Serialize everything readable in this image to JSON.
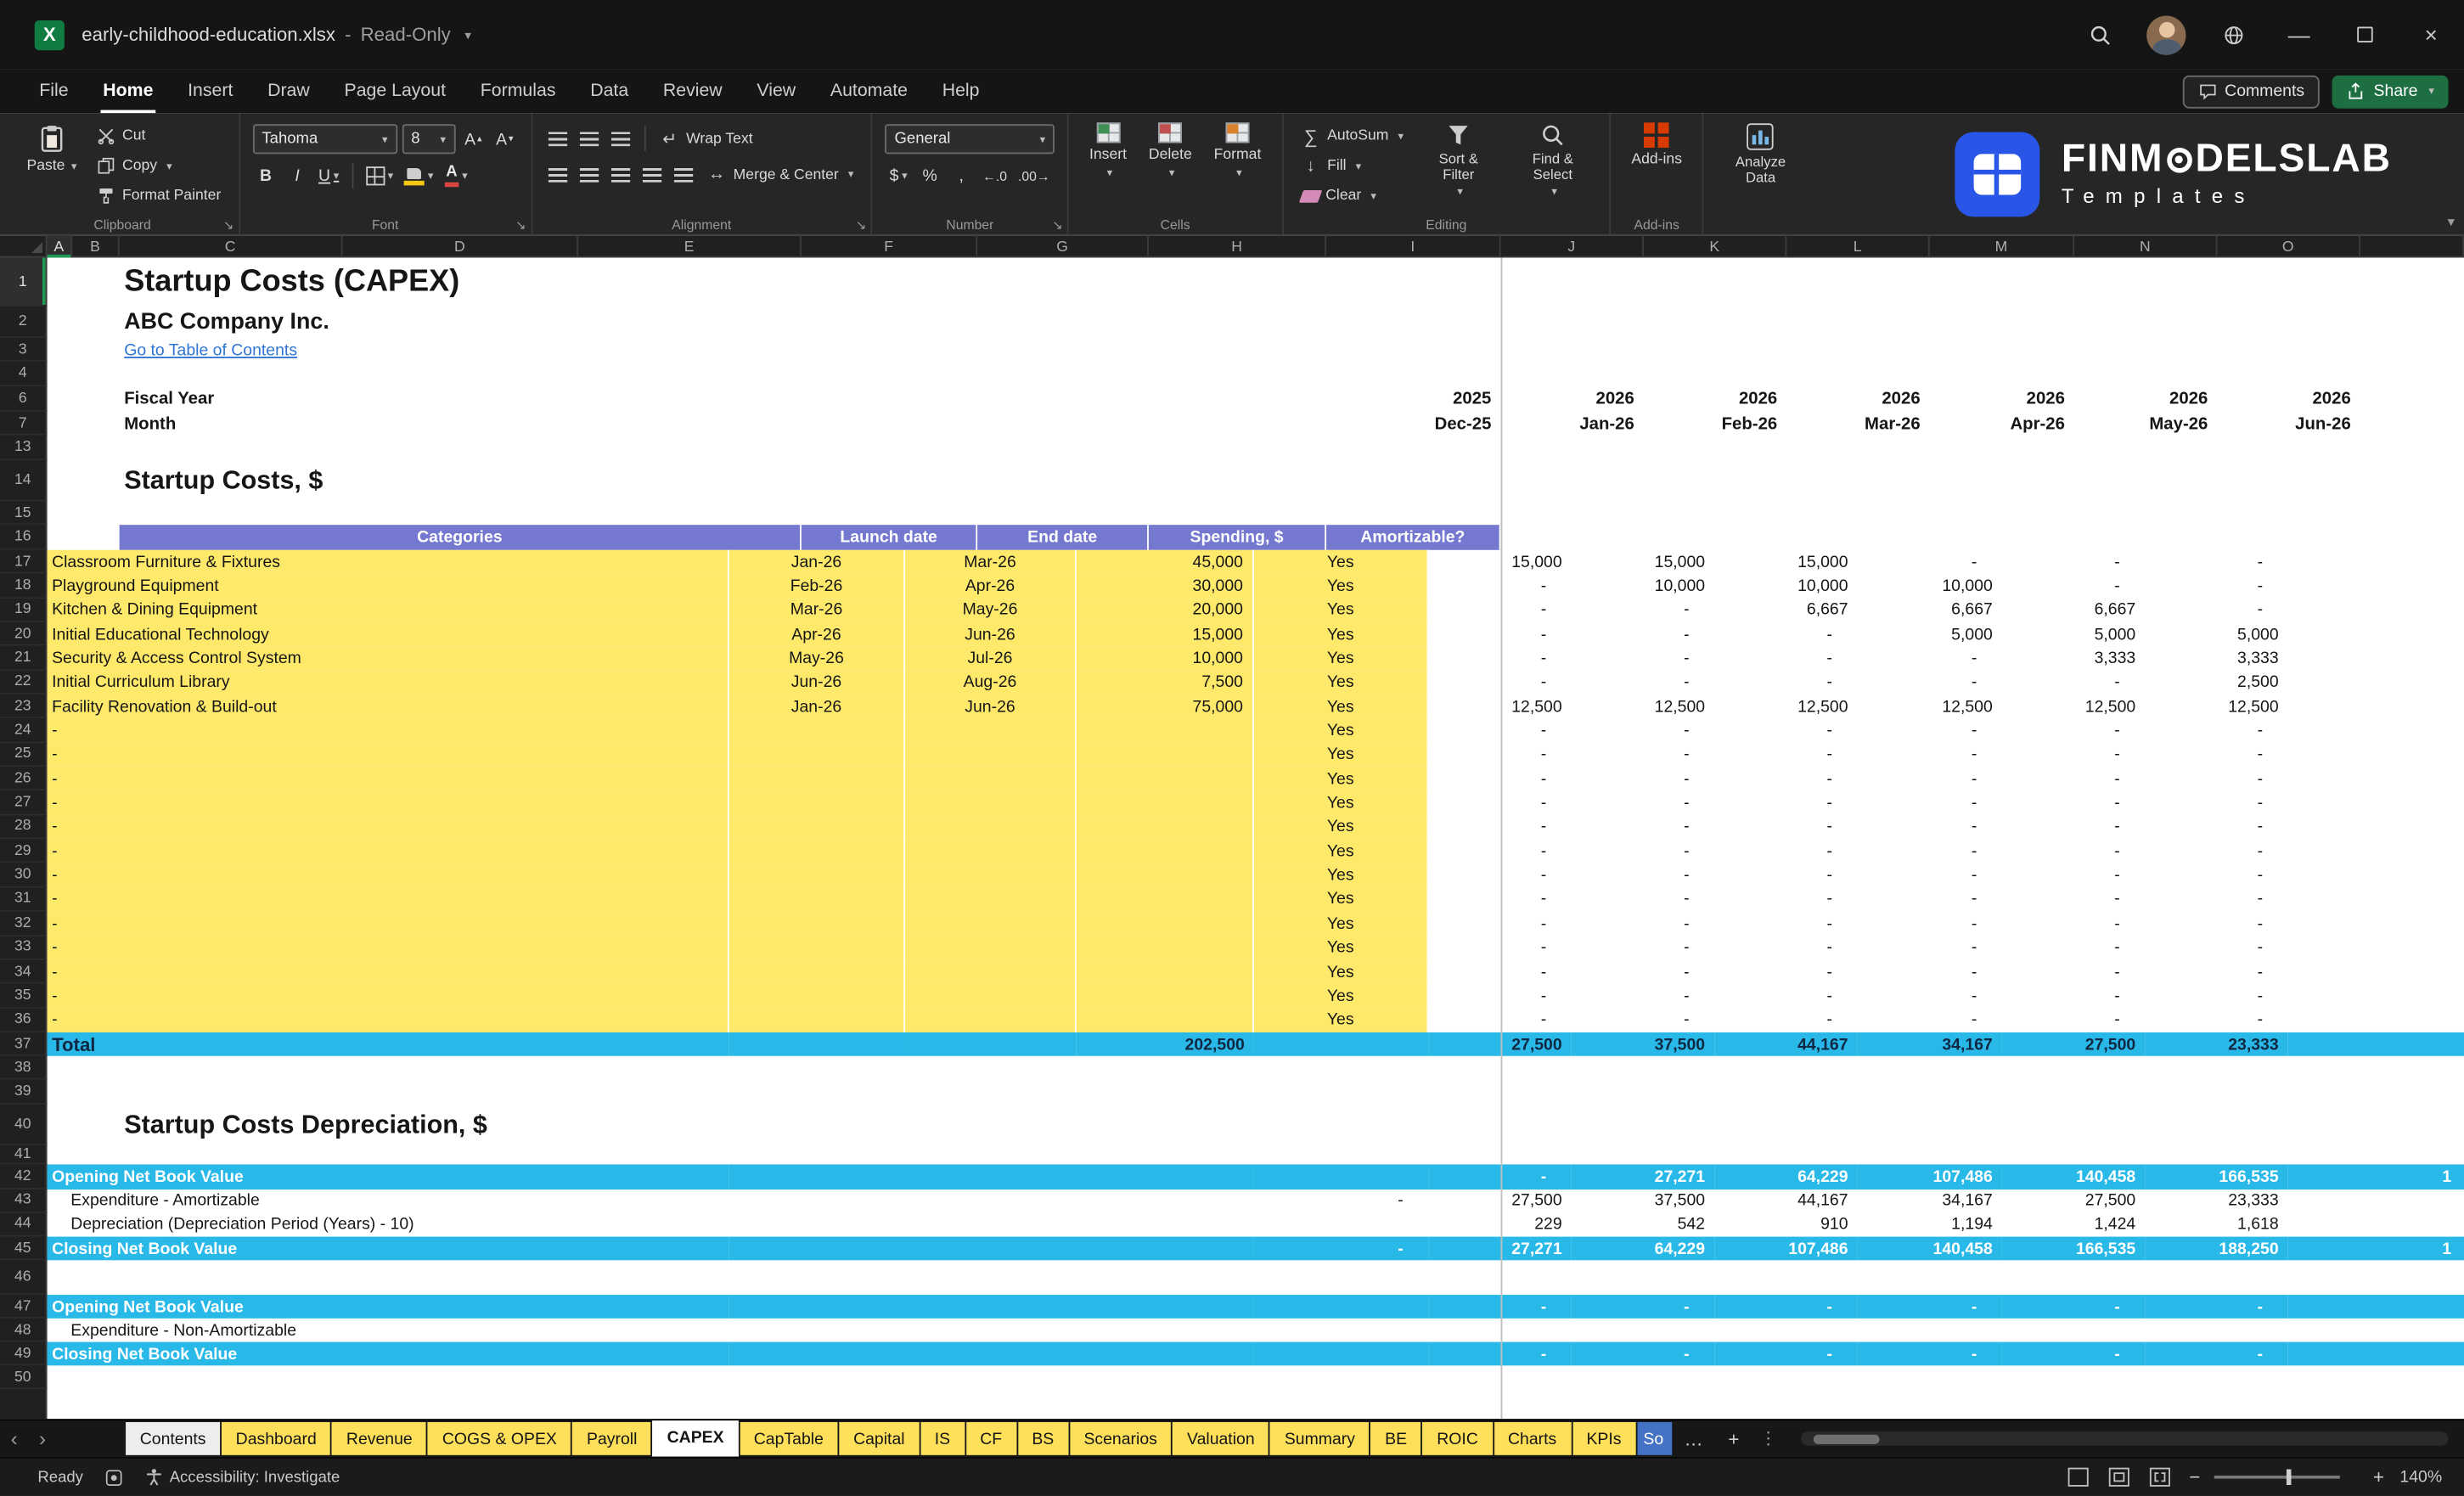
{
  "titlebar": {
    "app_icon_letter": "X",
    "filename": "early-childhood-education.xlsx",
    "separator": "-",
    "mode": "Read-Only"
  },
  "menubar": {
    "items": [
      "File",
      "Home",
      "Insert",
      "Draw",
      "Page Layout",
      "Formulas",
      "Data",
      "Review",
      "View",
      "Automate",
      "Help"
    ],
    "active": "Home",
    "comments_label": "Comments",
    "share_label": "Share"
  },
  "ribbon": {
    "clipboard": {
      "group": "Clipboard",
      "paste": "Paste",
      "cut": "Cut",
      "copy": "Copy",
      "format_painter": "Format Painter"
    },
    "font": {
      "group": "Font",
      "name": "Tahoma",
      "size": "8",
      "bold": "B",
      "italic": "I",
      "underline": "U"
    },
    "alignment": {
      "group": "Alignment",
      "wrap": "Wrap Text",
      "merge": "Merge & Center"
    },
    "number": {
      "group": "Number",
      "format": "General",
      "currency": "$",
      "percent": "%",
      "comma": ","
    },
    "cells": {
      "group": "Cells",
      "insert": "Insert",
      "delete": "Delete",
      "format": "Format"
    },
    "editing": {
      "group": "Editing",
      "autosum": "AutoSum",
      "fill": "Fill",
      "clear": "Clear",
      "sort": "Sort & Filter",
      "find": "Find & Select"
    },
    "addins": {
      "group": "Add-ins",
      "label": "Add-ins",
      "analyze": "Analyze Data"
    },
    "logo": {
      "brand_pre": "FINM",
      "brand_post": "DELSLAB",
      "subtitle": "Templates"
    }
  },
  "grid": {
    "columns": [
      "A",
      "B",
      "C",
      "D",
      "E",
      "F",
      "G",
      "H",
      "I",
      "J",
      "K",
      "L",
      "M",
      "N",
      "O"
    ],
    "rows": [
      "1",
      "2",
      "3",
      "4",
      "6",
      "7",
      "13",
      "14",
      "15",
      "16",
      "17",
      "18",
      "19",
      "20",
      "21",
      "22",
      "23",
      "24",
      "25",
      "26",
      "27",
      "28",
      "29",
      "30",
      "31",
      "32",
      "33",
      "34",
      "35",
      "36",
      "37",
      "38",
      "39",
      "40",
      "41",
      "42",
      "43",
      "44",
      "45",
      "46",
      "47",
      "48",
      "49",
      "50"
    ]
  },
  "sheet": {
    "title": "Startup Costs (CAPEX)",
    "company": "ABC Company Inc.",
    "toc_link": "Go to Table of Contents",
    "fiscal_year_label": "Fiscal Year",
    "month_label": "Month",
    "fy_first": "2025",
    "fy_values": [
      "2026",
      "2026",
      "2026",
      "2026",
      "2026",
      "2026"
    ],
    "month_first": "Dec-25",
    "month_values": [
      "Jan-26",
      "Feb-26",
      "Mar-26",
      "Apr-26",
      "May-26",
      "Jun-26"
    ],
    "section1_title": "Startup Costs, $",
    "header": {
      "categories": "Categories",
      "launch": "Launch date",
      "end": "End date",
      "spending": "Spending, $",
      "amortizable": "Amortizable?"
    },
    "capex_rows": [
      {
        "category": "Classroom Furniture & Fixtures",
        "launch": "Jan-26",
        "end": "Mar-26",
        "spending": "45,000",
        "amortizable": "Yes",
        "months": [
          "15,000",
          "15,000",
          "15,000",
          "-",
          "-",
          "-"
        ]
      },
      {
        "category": "Playground Equipment",
        "launch": "Feb-26",
        "end": "Apr-26",
        "spending": "30,000",
        "amortizable": "Yes",
        "months": [
          "-",
          "10,000",
          "10,000",
          "10,000",
          "-",
          "-"
        ]
      },
      {
        "category": "Kitchen & Dining Equipment",
        "launch": "Mar-26",
        "end": "May-26",
        "spending": "20,000",
        "amortizable": "Yes",
        "months": [
          "-",
          "-",
          "6,667",
          "6,667",
          "6,667",
          "-"
        ]
      },
      {
        "category": "Initial Educational Technology",
        "launch": "Apr-26",
        "end": "Jun-26",
        "spending": "15,000",
        "amortizable": "Yes",
        "months": [
          "-",
          "-",
          "-",
          "5,000",
          "5,000",
          "5,000"
        ]
      },
      {
        "category": "Security & Access Control System",
        "launch": "May-26",
        "end": "Jul-26",
        "spending": "10,000",
        "amortizable": "Yes",
        "months": [
          "-",
          "-",
          "-",
          "-",
          "3,333",
          "3,333"
        ]
      },
      {
        "category": "Initial Curriculum Library",
        "launch": "Jun-26",
        "end": "Aug-26",
        "spending": "7,500",
        "amortizable": "Yes",
        "months": [
          "-",
          "-",
          "-",
          "-",
          "-",
          "2,500"
        ]
      },
      {
        "category": "Facility Renovation & Build-out",
        "launch": "Jan-26",
        "end": "Jun-26",
        "spending": "75,000",
        "amortizable": "Yes",
        "months": [
          "12,500",
          "12,500",
          "12,500",
          "12,500",
          "12,500",
          "12,500"
        ]
      }
    ],
    "placeholder_row": {
      "category": "-",
      "launch": "",
      "end": "",
      "spending": "",
      "amortizable": "Yes",
      "months": [
        "-",
        "-",
        "-",
        "-",
        "-",
        "-"
      ]
    },
    "total_row": {
      "label": "Total",
      "spending": "202,500",
      "months": [
        "27,500",
        "37,500",
        "44,167",
        "34,167",
        "27,500",
        "23,333"
      ]
    },
    "section2_title": "Startup Costs Depreciation, $",
    "dep_rows": [
      {
        "label": "Opening Net Book Value",
        "style": "band",
        "i": "",
        "months": [
          "-",
          "27,271",
          "64,229",
          "107,486",
          "140,458",
          "166,535"
        ],
        "overflow": "1"
      },
      {
        "label": "Expenditure - Amortizable",
        "style": "plain",
        "i": "-",
        "months": [
          "27,500",
          "37,500",
          "44,167",
          "34,167",
          "27,500",
          "23,333"
        ]
      },
      {
        "label": "Depreciation (Depreciation Period (Years) - 10)",
        "style": "plain",
        "i": "",
        "months": [
          "229",
          "542",
          "910",
          "1,194",
          "1,424",
          "1,618"
        ]
      },
      {
        "label": "Closing Net Book Value",
        "style": "band",
        "i": "-",
        "months": [
          "27,271",
          "64,229",
          "107,486",
          "140,458",
          "166,535",
          "188,250"
        ],
        "overflow": "1"
      },
      {
        "label": "Opening Net Book Value",
        "style": "band",
        "i": "",
        "months": [
          "-",
          "-",
          "-",
          "-",
          "-",
          "-"
        ]
      },
      {
        "label": "Expenditure - Non-Amortizable",
        "style": "plain",
        "i": "",
        "months": [
          "",
          "",
          "",
          "",
          "",
          ""
        ]
      },
      {
        "label": "Closing Net Book Value",
        "style": "band",
        "i": "",
        "months": [
          "-",
          "-",
          "-",
          "-",
          "-",
          "-"
        ]
      }
    ]
  },
  "tabs": {
    "items": [
      {
        "label": "Contents",
        "style": "light"
      },
      {
        "label": "Dashboard",
        "style": "yellow"
      },
      {
        "label": "Revenue",
        "style": "yellow"
      },
      {
        "label": "COGS & OPEX",
        "style": "yellow"
      },
      {
        "label": "Payroll",
        "style": "yellow"
      },
      {
        "label": "CAPEX",
        "style": "active"
      },
      {
        "label": "CapTable",
        "style": "yellow"
      },
      {
        "label": "Capital",
        "style": "yellow"
      },
      {
        "label": "IS",
        "style": "yellow"
      },
      {
        "label": "CF",
        "style": "yellow"
      },
      {
        "label": "BS",
        "style": "yellow"
      },
      {
        "label": "Scenarios",
        "style": "yellow"
      },
      {
        "label": "Valuation",
        "style": "yellow"
      },
      {
        "label": "Summary",
        "style": "yellow"
      },
      {
        "label": "BE",
        "style": "yellow"
      },
      {
        "label": "ROIC",
        "style": "yellow"
      },
      {
        "label": "Charts",
        "style": "yellow"
      },
      {
        "label": "KPIs",
        "style": "yellow"
      },
      {
        "label": "So",
        "style": "blue"
      }
    ]
  },
  "statusbar": {
    "ready": "Ready",
    "accessibility": "Accessibility: Investigate",
    "zoom_out": "−",
    "zoom_in": "+",
    "zoom": "140%"
  },
  "icons": {
    "excel-app-icon": "green square X",
    "search-icon": "magnifier",
    "avatar": "user photo",
    "globe-icon": "globe",
    "minimize-icon": "—",
    "maximize-icon": "box",
    "close-icon": "×",
    "caret-icon": "▾",
    "dialog-launcher-icon": "↘",
    "paste-icon": "clipboard",
    "scissors-icon": "scissors",
    "copy-icon": "pages",
    "format-painter-icon": "brush",
    "borders-icon": "grid",
    "fill-color-icon": "bucket+yellow",
    "font-color-icon": "A+red",
    "align-lines-icon": "bars",
    "wrap-text-icon": "↵",
    "merge-icon": "↔",
    "autosum-icon": "∑",
    "fill-down-icon": "↓",
    "clear-icon": "eraser",
    "sort-filter-icon": "funnel",
    "find-select-icon": "magnifier",
    "insert-cells-icon": "grid green",
    "delete-cells-icon": "grid red",
    "format-cells-icon": "grid orange",
    "add-ins-icon": "orange grid",
    "analyze-data-icon": "bar chart",
    "comments-icon": "speech bubble",
    "share-icon": "arrow up box",
    "accessibility-icon": "person",
    "select-all-icon": "corner triangle"
  },
  "colors": {
    "table_header_purple": "#7478CF",
    "input_yellow": "#FFE96A",
    "band_cyan": "#29B9E8",
    "tab_yellow": "#FFE05A",
    "tab_blue": "#4472C4",
    "active_tab_white": "#FFFFFF",
    "share_green": "#1D6F42",
    "excel_green": "#107C41",
    "logo_blue": "#2A56E8",
    "link_blue": "#2E75D4"
  }
}
